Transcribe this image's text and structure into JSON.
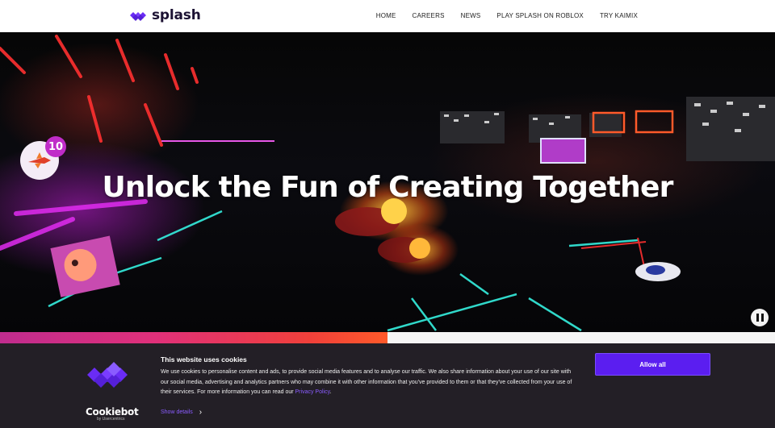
{
  "header": {
    "brand": "splash",
    "nav": [
      {
        "label": "HOME"
      },
      {
        "label": "CAREERS"
      },
      {
        "label": "NEWS"
      },
      {
        "label": "PLAY SPLASH ON ROBLOX"
      },
      {
        "label": "TRY KAIMIX"
      }
    ]
  },
  "hero": {
    "title": "Unlock the Fun of Creating Together",
    "badge_count": "10",
    "pause_icon": "pause-icon"
  },
  "cookie": {
    "title": "This website uses cookies",
    "text_before_link": "We use cookies to personalise content and ads, to provide social media features and to analyse our traffic. We also share information about your use of our site with our social media, advertising and analytics partners who may combine it with other information that you've provided to them or that they've collected from your use of their services. For more information you can read our ",
    "link_label": "Privacy Policy",
    "text_after_link": ".",
    "show_details": "Show details",
    "allow_all": "Allow all",
    "brand": "Cookiebot",
    "brand_sub": "by Usercentrics"
  },
  "colors": {
    "accent": "#5b1ef0",
    "brand_purple": "#6a2cf5",
    "banner_bg": "#231f26"
  }
}
